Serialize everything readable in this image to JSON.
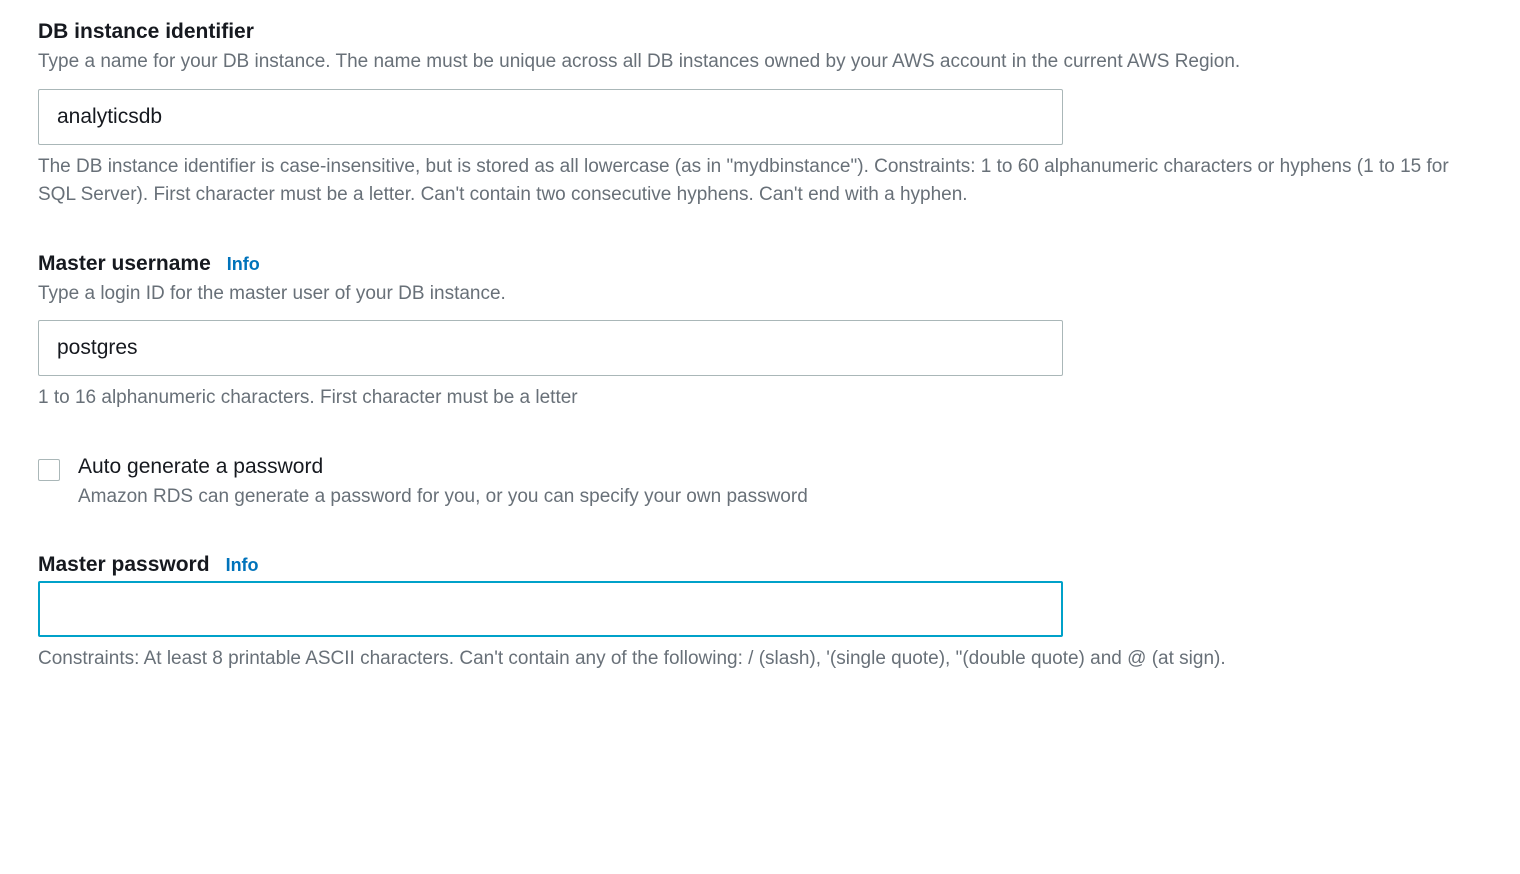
{
  "db_identifier": {
    "label": "DB instance identifier",
    "description": "Type a name for your DB instance. The name must be unique across all DB instances owned by your AWS account in the current AWS Region.",
    "value": "analyticsdb",
    "help": "The DB instance identifier is case-insensitive, but is stored as all lowercase (as in \"mydbinstance\"). Constraints: 1 to 60 alphanumeric characters or hyphens (1 to 15 for SQL Server). First character must be a letter. Can't contain two consecutive hyphens. Can't end with a hyphen."
  },
  "master_username": {
    "label": "Master username",
    "info_label": "Info",
    "description": "Type a login ID for the master user of your DB instance.",
    "value": "postgres",
    "help": "1 to 16 alphanumeric characters. First character must be a letter"
  },
  "auto_generate_password": {
    "label": "Auto generate a password",
    "description": "Amazon RDS can generate a password for you, or you can specify your own password",
    "checked": false
  },
  "master_password": {
    "label": "Master password",
    "info_label": "Info",
    "value": "",
    "help": "Constraints: At least 8 printable ASCII characters. Can't contain any of the following: / (slash), '(single quote), \"(double quote) and @ (at sign)."
  }
}
